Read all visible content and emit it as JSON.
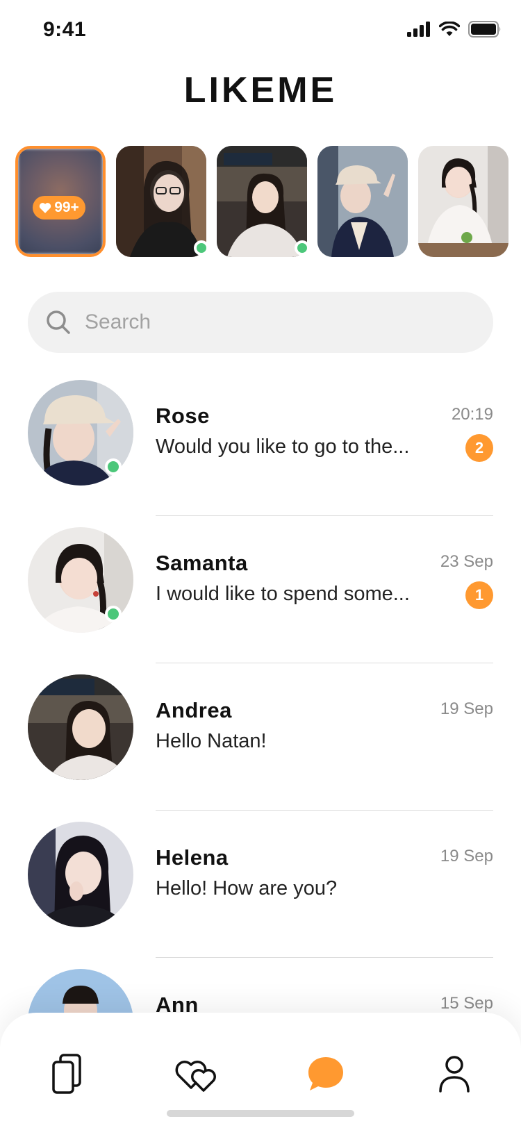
{
  "status_bar": {
    "time": "9:41"
  },
  "app": {
    "title": "LIKEME",
    "accent": "#ff9930",
    "online_color": "#4cc77a"
  },
  "likes_card": {
    "count_label": "99+"
  },
  "stories": [
    {
      "name": "likes-story",
      "online": false
    },
    {
      "name": "story-2",
      "online": true
    },
    {
      "name": "story-3",
      "online": true
    },
    {
      "name": "story-4",
      "online": false
    },
    {
      "name": "story-5",
      "online": false
    }
  ],
  "search": {
    "placeholder": "Search"
  },
  "chats": [
    {
      "name": "Rose",
      "message": "Would you like to go to the...",
      "time": "20:19",
      "unread": "2",
      "online": true
    },
    {
      "name": "Samanta",
      "message": "I would like to spend some...",
      "time": "23 Sep",
      "unread": "1",
      "online": true
    },
    {
      "name": "Andrea",
      "message": "Hello Natan!",
      "time": "19 Sep",
      "unread": null,
      "online": false
    },
    {
      "name": "Helena",
      "message": "Hello! How are you?",
      "time": "19 Sep",
      "unread": null,
      "online": false
    },
    {
      "name": "Ann",
      "message": "",
      "time": "15 Sep",
      "unread": null,
      "online": false
    }
  ],
  "nav": {
    "items": [
      {
        "icon": "cards-icon",
        "active": false
      },
      {
        "icon": "hearts-icon",
        "active": false
      },
      {
        "icon": "chat-bubble-icon",
        "active": true
      },
      {
        "icon": "profile-icon",
        "active": false
      }
    ]
  }
}
